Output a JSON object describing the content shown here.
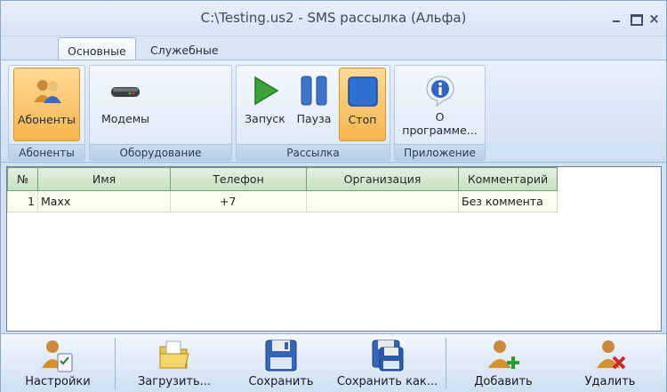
{
  "window": {
    "title": "C:\\Testing.us2 - SMS рассылка (Альфа)"
  },
  "tabs": [
    {
      "label": "Основные",
      "active": true
    },
    {
      "label": "Служебные",
      "active": false
    }
  ],
  "ribbon": {
    "groups": [
      {
        "label": "Абоненты",
        "buttons": [
          {
            "label": "Абоненты",
            "icon": "users-icon",
            "active": true
          }
        ]
      },
      {
        "label": "Оборудование",
        "buttons": [
          {
            "label": "Модемы",
            "icon": "modem-icon",
            "active": false
          }
        ]
      },
      {
        "label": "Рассылка",
        "buttons": [
          {
            "label": "Запуск",
            "icon": "play-icon",
            "active": false
          },
          {
            "label": "Пауза",
            "icon": "pause-icon",
            "active": false
          },
          {
            "label": "Стоп",
            "icon": "stop-icon",
            "active": true
          }
        ]
      },
      {
        "label": "Приложение",
        "buttons": [
          {
            "label": "О программе...",
            "icon": "info-icon",
            "active": false
          }
        ]
      }
    ]
  },
  "grid": {
    "columns": [
      "№",
      "Имя",
      "Телефон",
      "Организация",
      "Комментарий"
    ],
    "rows": [
      {
        "num": "1",
        "name": "Maxx",
        "phone": "+7",
        "org": "",
        "comment": "Без коммента"
      }
    ]
  },
  "toolbar": {
    "buttons": [
      {
        "label": "Настройки",
        "icon": "settings-user-icon"
      },
      {
        "label": "Загрузить...",
        "icon": "folder-open-icon"
      },
      {
        "label": "Сохранить",
        "icon": "save-icon"
      },
      {
        "label": "Сохранить как...",
        "icon": "save-as-icon"
      },
      {
        "label": "Добавить",
        "icon": "add-user-icon"
      },
      {
        "label": "Удалить",
        "icon": "delete-user-icon"
      }
    ]
  },
  "colors": {
    "accent_active": "#f7b54f",
    "grid_header": "#c4dfbf",
    "ribbon_bg": "#cfdff2"
  }
}
